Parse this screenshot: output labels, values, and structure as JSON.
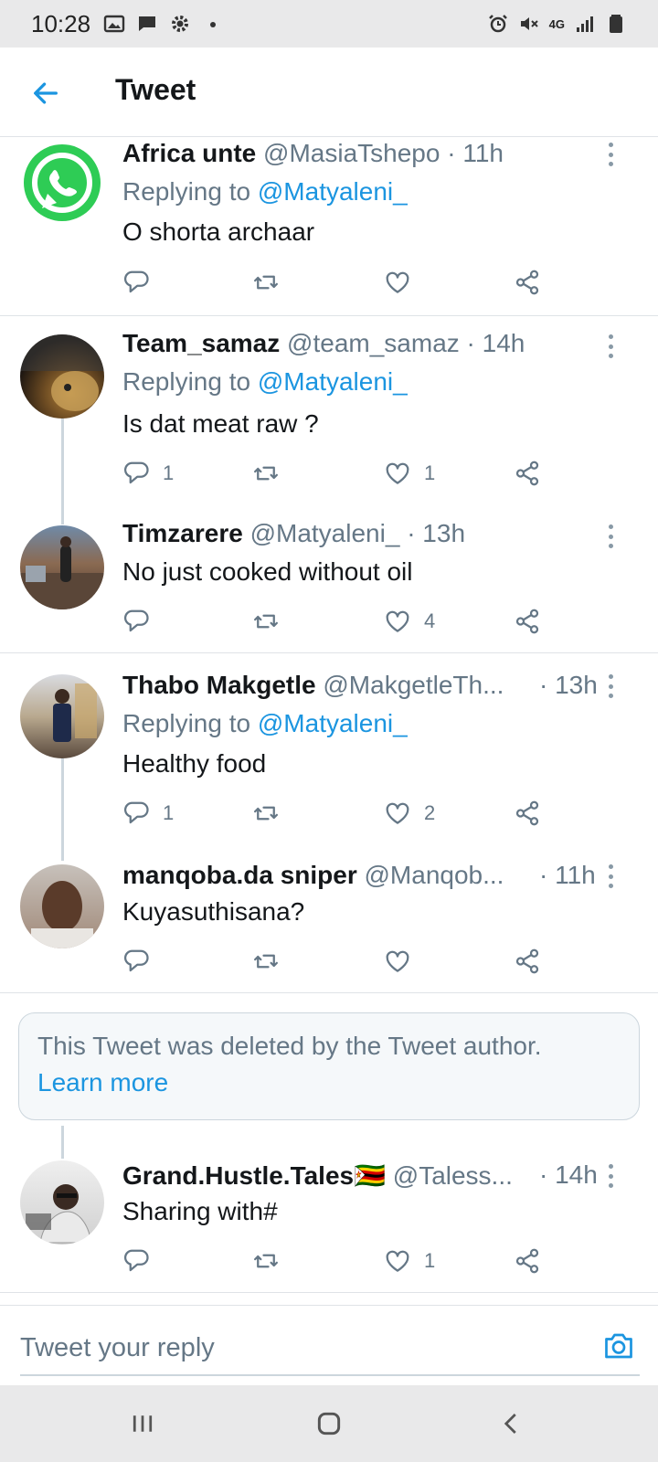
{
  "status_bar": {
    "time": "10:28",
    "network": "4G"
  },
  "header": {
    "title": "Tweet"
  },
  "tweets": [
    {
      "name": "Africa unte",
      "handle": "@MasiaTshepo",
      "time": "· 11h",
      "replying_prefix": "Replying to ",
      "replying_to": "@Matyaleni_",
      "text": "O shorta archaar",
      "replies": "",
      "likes": ""
    },
    {
      "name": "Team_samaz",
      "handle": "@team_samaz",
      "time": "· 14h",
      "replying_prefix": "Replying to ",
      "replying_to": "@Matyaleni_",
      "text": "Is dat meat raw ?",
      "replies": "1",
      "likes": "1"
    },
    {
      "name": "Timzarere",
      "handle": "@Matyaleni_",
      "time": "· 13h",
      "text": "No just cooked without oil",
      "replies": "",
      "likes": "4"
    },
    {
      "name": "Thabo Makgetle",
      "handle": "@MakgetleTh...",
      "time": "· 13h",
      "replying_prefix": "Replying to ",
      "replying_to": "@Matyaleni_",
      "text": "Healthy food",
      "replies": "1",
      "likes": "2"
    },
    {
      "name": "manqoba.da sniper",
      "handle": "@Manqob...",
      "time": "· 11h",
      "text": "Kuyasuthisana?",
      "replies": "",
      "likes": ""
    },
    {
      "name": "Grand.Hustle.Tales🇿🇼",
      "handle": "@Taless...",
      "time": "· 14h",
      "text": "Sharing with#",
      "replies": "",
      "likes": "1"
    }
  ],
  "deleted_notice": {
    "text": "This Tweet was deleted by the Tweet author.",
    "link": "Learn more"
  },
  "reply_bar": {
    "placeholder": "Tweet your reply"
  },
  "colors": {
    "accent": "#1b95e0",
    "whatsapp_green": "#2ecc55",
    "text_gray": "#657786"
  }
}
